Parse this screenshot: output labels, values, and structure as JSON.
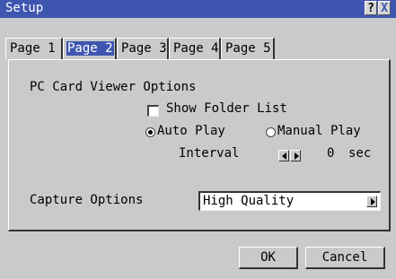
{
  "window": {
    "title": "Setup",
    "help_label": "?",
    "close_label": "X"
  },
  "tabs": [
    {
      "label": "Page 1",
      "active": false
    },
    {
      "label": "Page 2",
      "active": true
    },
    {
      "label": "Page 3",
      "active": false
    },
    {
      "label": "Page 4",
      "active": false
    },
    {
      "label": "Page 5",
      "active": false
    }
  ],
  "pc_card": {
    "heading": "PC Card Viewer Options",
    "show_folder_list_label": "Show Folder List",
    "show_folder_list_checked": false,
    "auto_play_label": "Auto Play",
    "manual_play_label": "Manual Play",
    "selected_play_mode": "Auto Play",
    "interval_label": "Interval",
    "interval_value": "0",
    "interval_unit": "sec"
  },
  "capture": {
    "label": "Capture Options",
    "selected": "High Quality"
  },
  "buttons": {
    "ok": "OK",
    "cancel": "Cancel"
  },
  "colors": {
    "accent": "#3f56b1",
    "background": "#c9cac9"
  }
}
